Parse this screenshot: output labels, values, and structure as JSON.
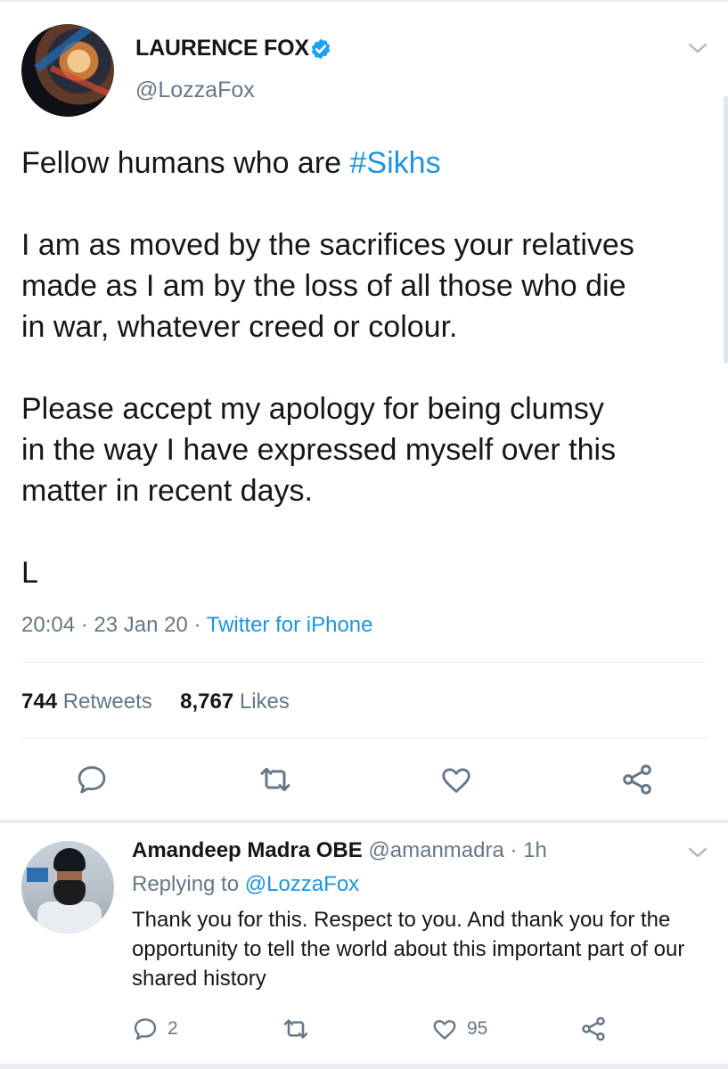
{
  "tweet": {
    "author_name": "LAURENCE FOX",
    "author_handle": "@LozzaFox",
    "text_line1_prefix": "Fellow humans who are ",
    "hashtag": "#Sikhs",
    "text_body": "I am as moved by the sacrifices your relatives\nmade as I am by the loss of all those who die\nin war, whatever creed or colour.\n\nPlease accept my apology for being clumsy\nin the way I have expressed myself over this\nmatter in recent days.\n\nL",
    "time": "20:04",
    "date": "23 Jan 20",
    "source": "Twitter for iPhone",
    "retweets_count": "744",
    "retweets_label": "Retweets",
    "likes_count": "8,767",
    "likes_label": "Likes"
  },
  "reply": {
    "author_name": "Amandeep Madra OBE",
    "author_handle": "@amanmadra",
    "age": "1h",
    "replying_to_prefix": "Replying to ",
    "replying_to_handle": "@LozzaFox",
    "text": "Thank you for this. Respect to you. And thank you for the opportunity to tell the world about this important part of our shared history",
    "reply_count": "2",
    "like_count": "95"
  },
  "colors": {
    "link_blue": "#1b95e0",
    "secondary_gray": "#657786",
    "divider": "#e6ecf0"
  },
  "icons": [
    "verified-badge-icon",
    "chevron-down-icon",
    "reply-icon",
    "retweet-icon",
    "like-icon",
    "share-icon"
  ]
}
